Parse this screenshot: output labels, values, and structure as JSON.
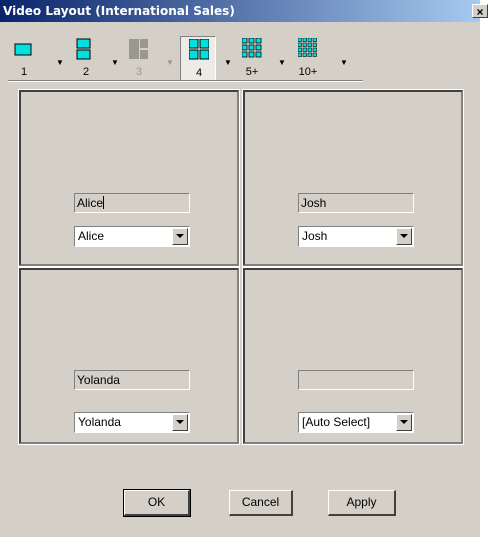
{
  "window": {
    "title": "Video Layout (International Sales)",
    "close_label": "×"
  },
  "toolbar": {
    "layouts": [
      {
        "label": "1",
        "icon": "layout-1-icon",
        "enabled": true,
        "selected": false
      },
      {
        "label": "2",
        "icon": "layout-2-icon",
        "enabled": true,
        "selected": false
      },
      {
        "label": "3",
        "icon": "layout-3-icon",
        "enabled": false,
        "selected": false
      },
      {
        "label": "4",
        "icon": "layout-4-icon",
        "enabled": true,
        "selected": true
      },
      {
        "label": "5+",
        "icon": "layout-5plus-icon",
        "enabled": true,
        "selected": false
      },
      {
        "label": "10+",
        "icon": "layout-10plus-icon",
        "enabled": true,
        "selected": false
      }
    ],
    "icon_color": "#00e0e0"
  },
  "panes": [
    {
      "name": "Alice",
      "selected": "Alice"
    },
    {
      "name": "Josh",
      "selected": "Josh"
    },
    {
      "name": "Yolanda",
      "selected": "Yolanda"
    },
    {
      "name": "",
      "selected": "[Auto Select]"
    }
  ],
  "buttons": {
    "ok": "OK",
    "cancel": "Cancel",
    "apply": "Apply"
  }
}
